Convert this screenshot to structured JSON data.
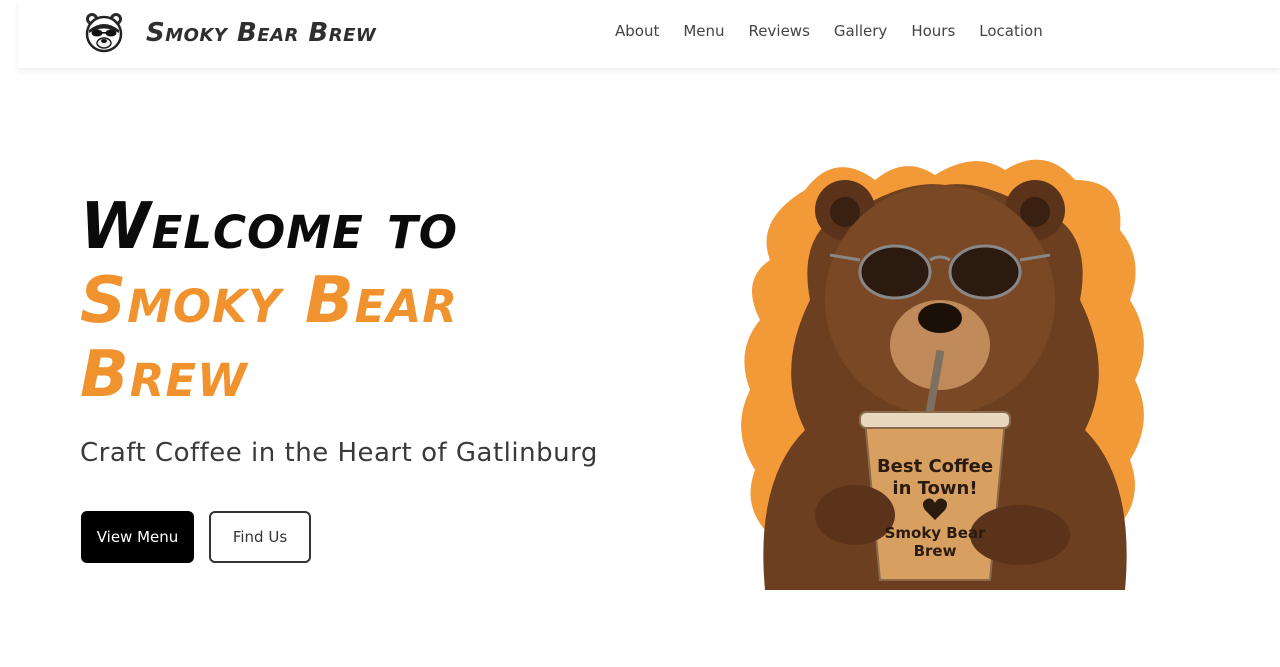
{
  "header": {
    "brand": "Smoky Bear Brew",
    "nav": [
      "About",
      "Menu",
      "Reviews",
      "Gallery",
      "Hours",
      "Location"
    ]
  },
  "hero": {
    "title_line1": "Welcome to",
    "title_line2": "Smoky Bear Brew",
    "subtitle": "Craft Coffee in the Heart of Gatlinburg",
    "primary_button": "View Menu",
    "secondary_button": "Find Us",
    "cup_text_1": "Best Coffee",
    "cup_text_2": "in Town!",
    "cup_text_3": "Smoky Bear",
    "cup_text_4": "Brew"
  },
  "colors": {
    "accent": "#f0922e",
    "primary_button_bg": "#000000",
    "title_dark": "#0b0b0b"
  },
  "icons": {
    "logo": "bear-face-logo-icon",
    "hero": "bear-with-iced-coffee-illustration"
  }
}
